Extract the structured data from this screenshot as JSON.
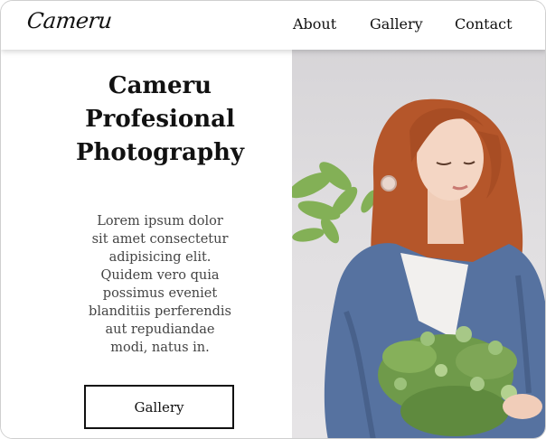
{
  "brand": {
    "logo": "Cameru"
  },
  "nav": {
    "about": "About",
    "gallery": "Gallery",
    "contact": "Contact"
  },
  "hero": {
    "title_line1": "Cameru",
    "title_line2": "Profesional",
    "title_line3": "Photography",
    "body_lines": [
      "Lorem ipsum dolor",
      "sit amet consectetur",
      "adipisicing elit.",
      "Quidem vero quia",
      "possimus eveniet",
      "blanditiis perferendis",
      "aut repudiandae",
      "modi, natus in."
    ],
    "button": "Gallery"
  },
  "colors": {
    "text": "#111111",
    "body_text": "#444444",
    "photo_bg": "#dedcdf",
    "hair": "#b5562a",
    "sweater": "#5672a0",
    "foliage": "#6f9a4a"
  }
}
